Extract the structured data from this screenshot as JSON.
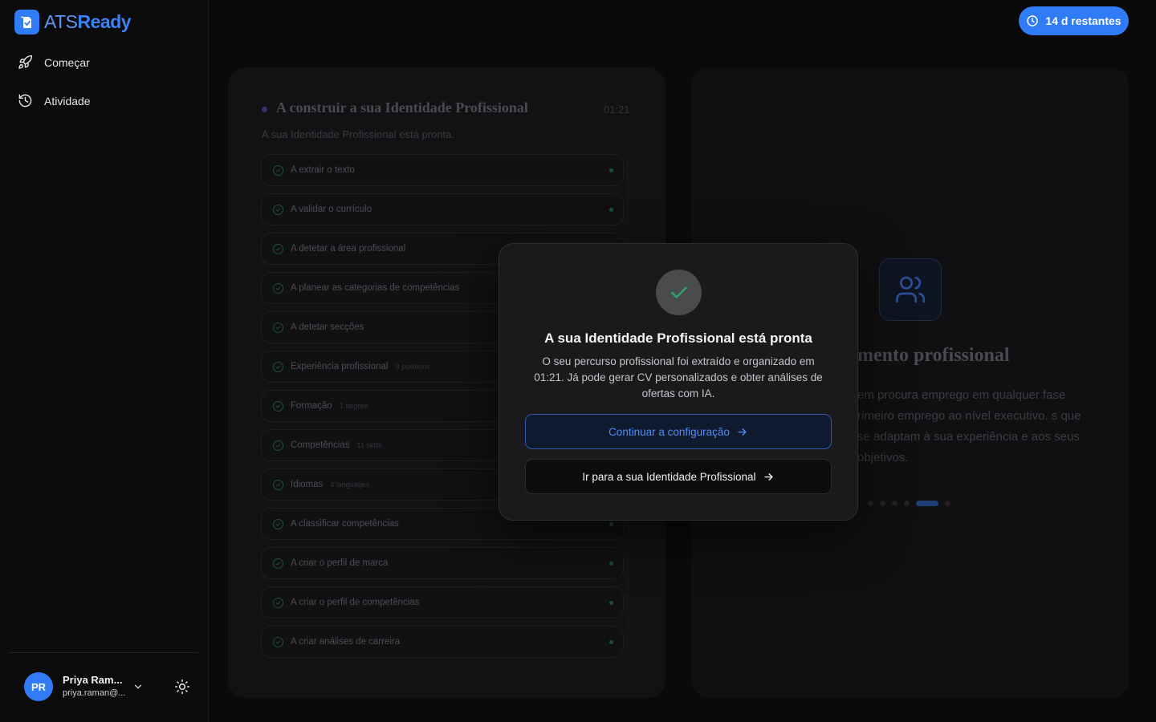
{
  "app": {
    "name_part1": "ATS",
    "name_part2": "Ready"
  },
  "sidebar": {
    "items": [
      {
        "label": "Começar",
        "icon": "rocket-icon"
      },
      {
        "label": "Atividade",
        "icon": "history-icon"
      }
    ],
    "user": {
      "initials": "PR",
      "name": "Priya Ram...",
      "email": "priya.raman@..."
    }
  },
  "header": {
    "trial_label": "14 d restantes"
  },
  "build": {
    "title": "A construir a sua Identidade Profissional",
    "time": "01:21",
    "subtitle": "A sua Identidade Profissional está pronta.",
    "steps": [
      {
        "label": "A extrair o texto",
        "meta": ""
      },
      {
        "label": "A validar o currículo",
        "meta": ""
      },
      {
        "label": "A detetar a área profissional",
        "meta": ""
      },
      {
        "label": "A planear as categorias de competências",
        "meta": ""
      },
      {
        "label": "A detetar secções",
        "meta": ""
      },
      {
        "label": "Experiência profissional",
        "meta": "3 positions"
      },
      {
        "label": "Formação",
        "meta": "1 degree"
      },
      {
        "label": "Competências",
        "meta": "11 skills"
      },
      {
        "label": "Idiomas",
        "meta": "4 languages"
      },
      {
        "label": "A classificar competências",
        "meta": ""
      },
      {
        "label": "A criar o perfil de marca",
        "meta": ""
      },
      {
        "label": "A criar o perfil de competências",
        "meta": ""
      },
      {
        "label": "A criar análises de carreira",
        "meta": ""
      }
    ]
  },
  "feature": {
    "title": "mento profissional",
    "text": "em procura emprego em qualquer fase rimeiro emprego ao nível executivo. s que se adaptam à sua experiência e aos seus objetivos."
  },
  "modal": {
    "title": "A sua Identidade Profissional está pronta",
    "text": "O seu percurso profissional foi extraído e organizado em 01:21. Já pode gerar CV personalizados e obter análises de ofertas com IA.",
    "primary_label": "Continuar a configuração",
    "secondary_label": "Ir para a sua Identidade Profissional"
  },
  "colors": {
    "accent": "#2f7cf6",
    "background": "#0a0a0b",
    "modal": "#1a1a1d"
  }
}
